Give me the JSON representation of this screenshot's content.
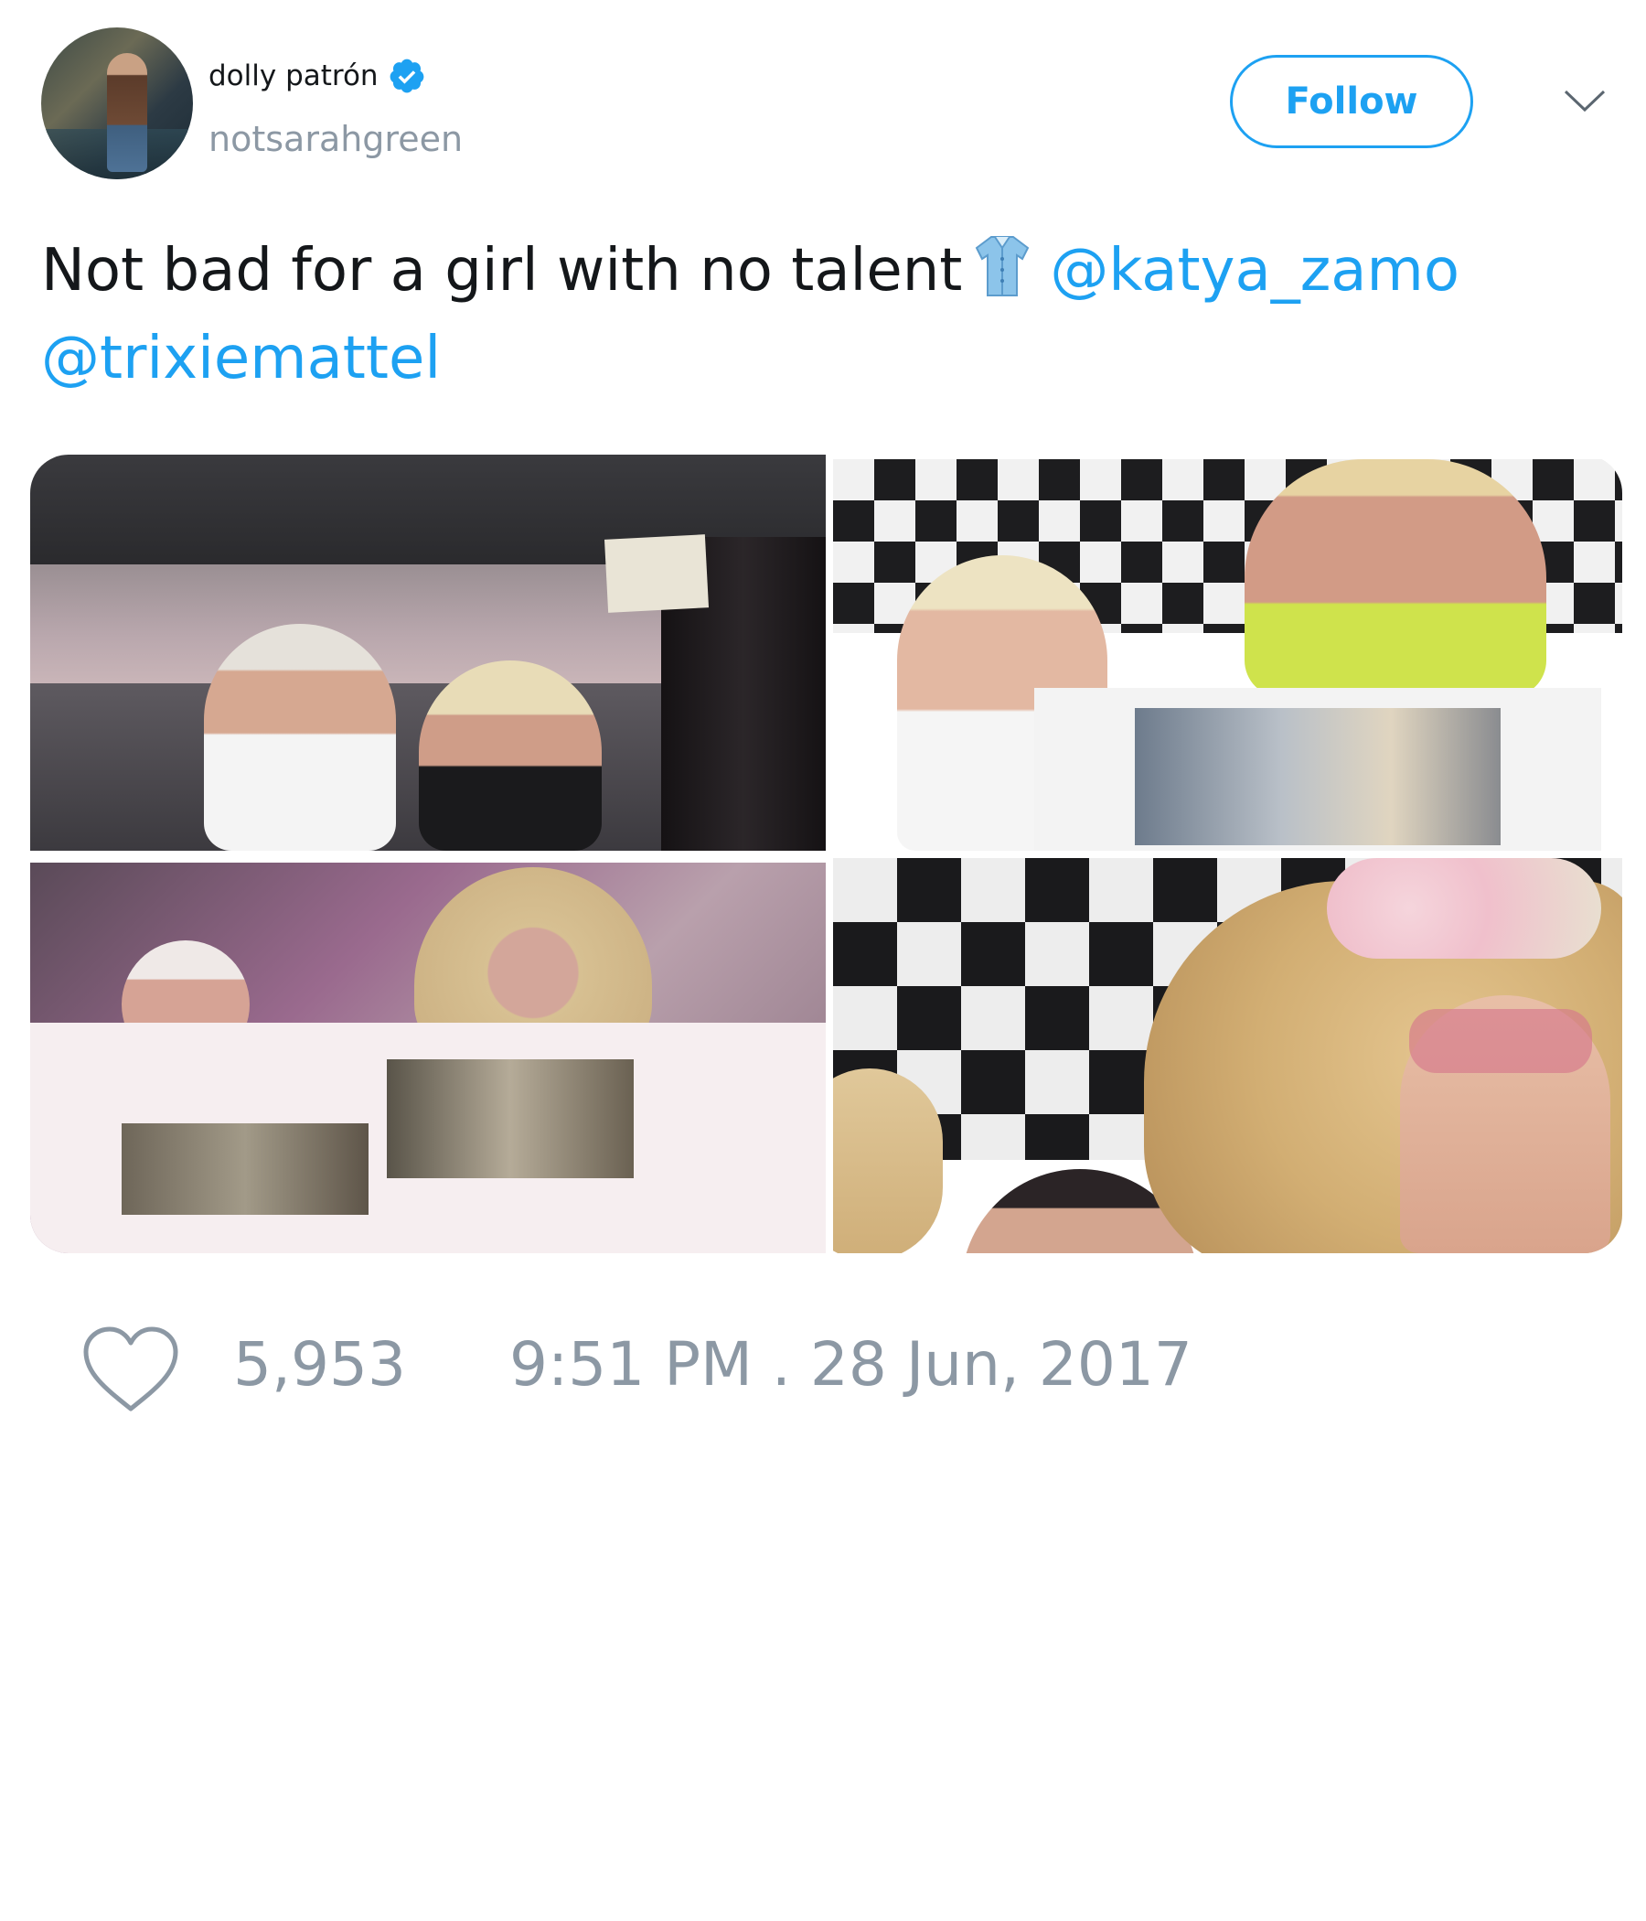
{
  "header": {
    "display_name": "dolly patrón",
    "username": "notsarahgreen",
    "follow_label": "Follow",
    "verified": true
  },
  "tweet": {
    "text": "Not bad for a girl with no talent",
    "emoji": "shirt-icon",
    "mentions": [
      "@katya_zamo",
      "@trixiemattel"
    ]
  },
  "media": {
    "photo_count": 4,
    "photos": [
      {
        "description_icon": "photo"
      },
      {
        "description_icon": "photo"
      },
      {
        "description_icon": "photo"
      },
      {
        "description_icon": "photo"
      }
    ]
  },
  "footer": {
    "like_count": "5,953",
    "timestamp": "9:51 PM . 28 Jun, 2017"
  },
  "colors": {
    "accent": "#1da1f2",
    "text": "#14171a",
    "muted": "#8c98a4"
  }
}
